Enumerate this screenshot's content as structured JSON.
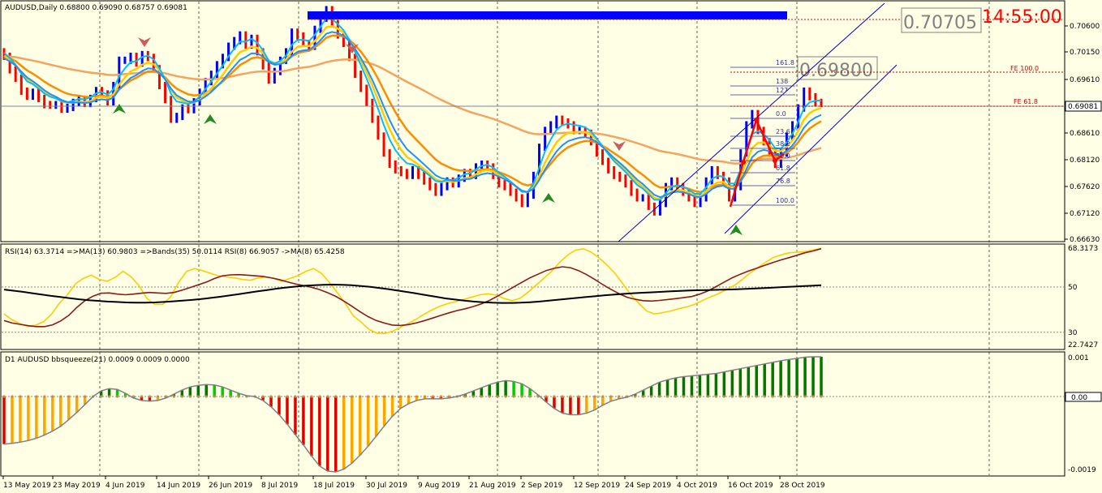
{
  "symbol_header": "AUDUSD,Daily  0.68800 0.69090 0.68757 0.69081",
  "rsi_header": "RSI(14) 63.3714  =>MA(13) 60.9803  =>Bands(35) 50.0114  RSI(8) 66.9057  ->MA(8) 65.4258",
  "bb_header": "D1 AUDUSD bbsqueeze(21) 0.0009 0.0009 0.0000",
  "big_price": "0.70705",
  "clock": "14:55:00",
  "target_box": "0.69800",
  "price_axis": [
    "0.70600",
    "0.70150",
    "0.69610",
    "0.69081",
    "0.68610",
    "0.68120",
    "0.67620",
    "0.67120",
    "0.66630"
  ],
  "current_price": "0.69081",
  "rsi_axis": [
    "68.3173",
    "50",
    "30",
    "22.7427"
  ],
  "bb_axis": [
    "0.001",
    "0.00",
    "-0.0019"
  ],
  "fib_labels": [
    "161.8",
    "138",
    "127",
    "0.0",
    "23.6",
    "38.2",
    "50.0",
    "61.8",
    "76.8",
    "100.0"
  ],
  "fe_labels": [
    "FE 100.0",
    "FE 61.8"
  ],
  "date_labels": [
    "13 May 2019",
    "23 May 2019",
    "4 Jun 2019",
    "14 Jun 2019",
    "26 Jun 2019",
    "8 Jul 2019",
    "18 Jul 2019",
    "30 Jul 2019",
    "9 Aug 2019",
    "21 Aug 2019",
    "2 Sep 2019",
    "12 Sep 2019",
    "24 Sep 2019",
    "4 Oct 2019",
    "16 Oct 2019",
    "28 Oct 2019"
  ],
  "colors": {
    "bg": "#ffffe6",
    "bull": "#0000ff",
    "bear": "#ff0000",
    "ma_fast": "#ffcc00",
    "ma_mid": "#ff8c00",
    "ma_slow": "#f4a460",
    "bb_lime": "#00cc00",
    "bb_dark": "#007700",
    "bb_red": "#dd0000",
    "bb_orange": "#ffa500"
  },
  "chart_data": {
    "type": "candlestick",
    "price": {
      "ylim": [
        0.6663,
        0.7086
      ],
      "closes": [
        0.6992,
        0.6968,
        0.6953,
        0.693,
        0.6921,
        0.6928,
        0.6917,
        0.6906,
        0.6905,
        0.6906,
        0.6898,
        0.6901,
        0.691,
        0.6915,
        0.6908,
        0.6917,
        0.6931,
        0.6925,
        0.6911,
        0.694,
        0.6985,
        0.6985,
        0.6992,
        0.698,
        0.6995,
        0.699,
        0.697,
        0.694,
        0.6915,
        0.688,
        0.6885,
        0.69,
        0.6897,
        0.6911,
        0.6928,
        0.6947,
        0.696,
        0.6977,
        0.699,
        0.701,
        0.702,
        0.703,
        0.7012,
        0.7024,
        0.7,
        0.6975,
        0.695,
        0.6965,
        0.6985,
        0.7,
        0.7035,
        0.7028,
        0.7015,
        0.701,
        0.704,
        0.706,
        0.7075,
        0.705,
        0.703,
        0.7015,
        0.699,
        0.696,
        0.6935,
        0.691,
        0.688,
        0.685,
        0.682,
        0.68,
        0.679,
        0.6785,
        0.678,
        0.679,
        0.678,
        0.677,
        0.676,
        0.675,
        0.676,
        0.677,
        0.6765,
        0.6775,
        0.6785,
        0.678,
        0.6795,
        0.68,
        0.6795,
        0.678,
        0.6765,
        0.676,
        0.675,
        0.674,
        0.673,
        0.6745,
        0.678,
        0.683,
        0.686,
        0.687,
        0.688,
        0.6875,
        0.687,
        0.686,
        0.686,
        0.6855,
        0.684,
        0.682,
        0.6805,
        0.679,
        0.678,
        0.6775,
        0.6765,
        0.675,
        0.674,
        0.674,
        0.6725,
        0.6715,
        0.673,
        0.676,
        0.677,
        0.676,
        0.675,
        0.674,
        0.673,
        0.674,
        0.677,
        0.679,
        0.678,
        0.677,
        0.674,
        0.676,
        0.682,
        0.687,
        0.689,
        0.686,
        0.684,
        0.682,
        0.68,
        0.682,
        0.685,
        0.687,
        0.69,
        0.693,
        0.692,
        0.691,
        0.6908
      ]
    },
    "rsi": {
      "ylim": [
        22.7427,
        68.3173
      ],
      "levels": [
        30,
        50
      ],
      "series": [
        {
          "color": "#ffcc00",
          "values": [
            38.1,
            35.5,
            33.8,
            32.6,
            33.1,
            34.8,
            38.1,
            43.0,
            46.6,
            51.5,
            53.9,
            55.3,
            53.4,
            52.6,
            54.3,
            57.0,
            54.6,
            50.7,
            45.0,
            42.3,
            42.3,
            45.7,
            52.1,
            56.9,
            58.2,
            57.3,
            56.1,
            55.0,
            54.5,
            54.1,
            53.4,
            53.0,
            54.0,
            54.5,
            53.9,
            52.6,
            53.8,
            55.0,
            56.9,
            58.2,
            56.1,
            52.1,
            47.6,
            42.8,
            37.4,
            34.5,
            31.3,
            29.6,
            29.5,
            30.5,
            32.3,
            34.0,
            35.9,
            38.1,
            40.0,
            41.6,
            42.8,
            43.6,
            44.6,
            45.6,
            46.6,
            47.0,
            46.5,
            45.0,
            44.0,
            45.0,
            47.6,
            50.7,
            53.8,
            56.9,
            60.8,
            64.0,
            66.3,
            67.0,
            65.5,
            62.9,
            59.7,
            56.1,
            51.4,
            46.6,
            42.8,
            39.4,
            38.1,
            38.7,
            39.4,
            40.4,
            41.2,
            42.3,
            44.0,
            45.6,
            47.0,
            48.8,
            50.6,
            53.2,
            56.1,
            58.6,
            61.0,
            63.2,
            64.3,
            65.2,
            65.4,
            65.7,
            66.4,
            67.1
          ]
        },
        {
          "color": "#8b1a1a",
          "values": [
            35.2,
            34.1,
            33.5,
            32.9,
            32.5,
            32.5,
            33.3,
            35.0,
            37.5,
            41.0,
            44.0,
            46.0,
            47.3,
            47.4,
            46.9,
            46.6,
            46.9,
            47.3,
            47.6,
            47.4,
            47.2,
            47.6,
            48.6,
            49.8,
            51.0,
            52.2,
            53.8,
            55.0,
            55.4,
            55.5,
            55.3,
            55.0,
            54.7,
            54.1,
            53.3,
            52.3,
            51.4,
            50.7,
            49.9,
            48.9,
            47.5,
            45.9,
            43.8,
            41.5,
            39.1,
            36.9,
            35.2,
            34.1,
            33.2,
            33.0,
            33.4,
            34.2,
            35.2,
            36.3,
            37.5,
            38.6,
            39.6,
            40.4,
            41.4,
            42.6,
            44.1,
            46.0,
            48.0,
            50.1,
            52.1,
            54.1,
            55.7,
            57.3,
            58.3,
            59.0,
            58.6,
            57.3,
            55.5,
            53.4,
            51.1,
            49.0,
            47.1,
            45.5,
            44.6,
            44.0,
            43.8,
            44.1,
            44.5,
            44.9,
            45.3,
            45.8,
            46.9,
            48.3,
            50.2,
            52.2,
            54.1,
            55.7,
            57.1,
            58.3,
            59.6,
            60.8,
            62.0,
            63.0,
            64.1,
            65.2,
            66.0,
            67.0
          ]
        },
        {
          "color": "#000000",
          "values": [
            48.9,
            48.4,
            47.9,
            47.3,
            46.7,
            46.1,
            45.6,
            45.1,
            44.6,
            44.2,
            43.9,
            43.6,
            43.4,
            43.2,
            43.1,
            43.1,
            43.2,
            43.4,
            43.7,
            44.0,
            44.3,
            44.7,
            45.2,
            45.7,
            46.3,
            46.9,
            47.5,
            48.1,
            48.7,
            49.3,
            49.8,
            50.2,
            50.6,
            50.8,
            51.0,
            51.1,
            51.0,
            50.8,
            50.5,
            50.1,
            49.6,
            49.0,
            48.4,
            47.8,
            47.1,
            46.4,
            45.7,
            45.0,
            44.5,
            44.0,
            43.6,
            43.3,
            43.1,
            43.0,
            43.0,
            43.1,
            43.3,
            43.6,
            44.0,
            44.4,
            44.8,
            45.2,
            45.6,
            46.0,
            46.4,
            46.7,
            47.0,
            47.3,
            47.5,
            47.7,
            47.9,
            48.1,
            48.3,
            48.5,
            48.6,
            48.7,
            48.8,
            48.9,
            49.0,
            49.2,
            49.4,
            49.6,
            49.8,
            50.0,
            50.2,
            50.4,
            50.6,
            50.8
          ]
        }
      ]
    },
    "bbsqueeze": {
      "ylim": [
        -0.0019,
        0.001
      ],
      "values": [
        -0.0012,
        -0.00118,
        -0.00115,
        -0.00111,
        -0.00105,
        -0.00097,
        -0.00087,
        -0.00075,
        -0.00058,
        -0.0004,
        -0.0002,
        0.0,
        0.00014,
        0.0002,
        0.00018,
        8e-05,
        -4e-05,
        -0.0001,
        -0.00012,
        -0.0001,
        -4e-05,
        6e-05,
        0.00016,
        0.00024,
        0.00028,
        0.0003,
        0.00029,
        0.00024,
        0.00016,
        8e-05,
        2e-05,
        0.0,
        -0.0001,
        -0.00026,
        -0.00046,
        -0.0007,
        -0.00096,
        -0.00122,
        -0.0015,
        -0.00175,
        -0.00188,
        -0.0019,
        -0.00183,
        -0.00168,
        -0.00148,
        -0.00125,
        -0.001,
        -0.00074,
        -0.0005,
        -0.0003,
        -0.00018,
        -0.0001,
        -6e-05,
        -6e-05,
        -6e-05,
        -4e-05,
        0.0,
        6e-05,
        0.00014,
        0.00022,
        0.0003,
        0.00036,
        0.0004,
        0.00038,
        0.00032,
        0.0002,
        4e-05,
        -0.00014,
        -0.0003,
        -0.00042,
        -0.00046,
        -0.00046,
        -0.00042,
        -0.00034,
        -0.00022,
        -0.00012,
        -6e-05,
        -2e-05,
        6e-05,
        0.00016,
        0.00026,
        0.00036,
        0.00042,
        0.00047,
        0.0005,
        0.00052,
        0.00054,
        0.00056,
        0.00058,
        0.00062,
        0.00066,
        0.0007,
        0.00074,
        0.00078,
        0.00082,
        0.00086,
        0.0009,
        0.00093,
        0.00096,
        0.00099,
        0.001,
        0.001
      ]
    }
  }
}
